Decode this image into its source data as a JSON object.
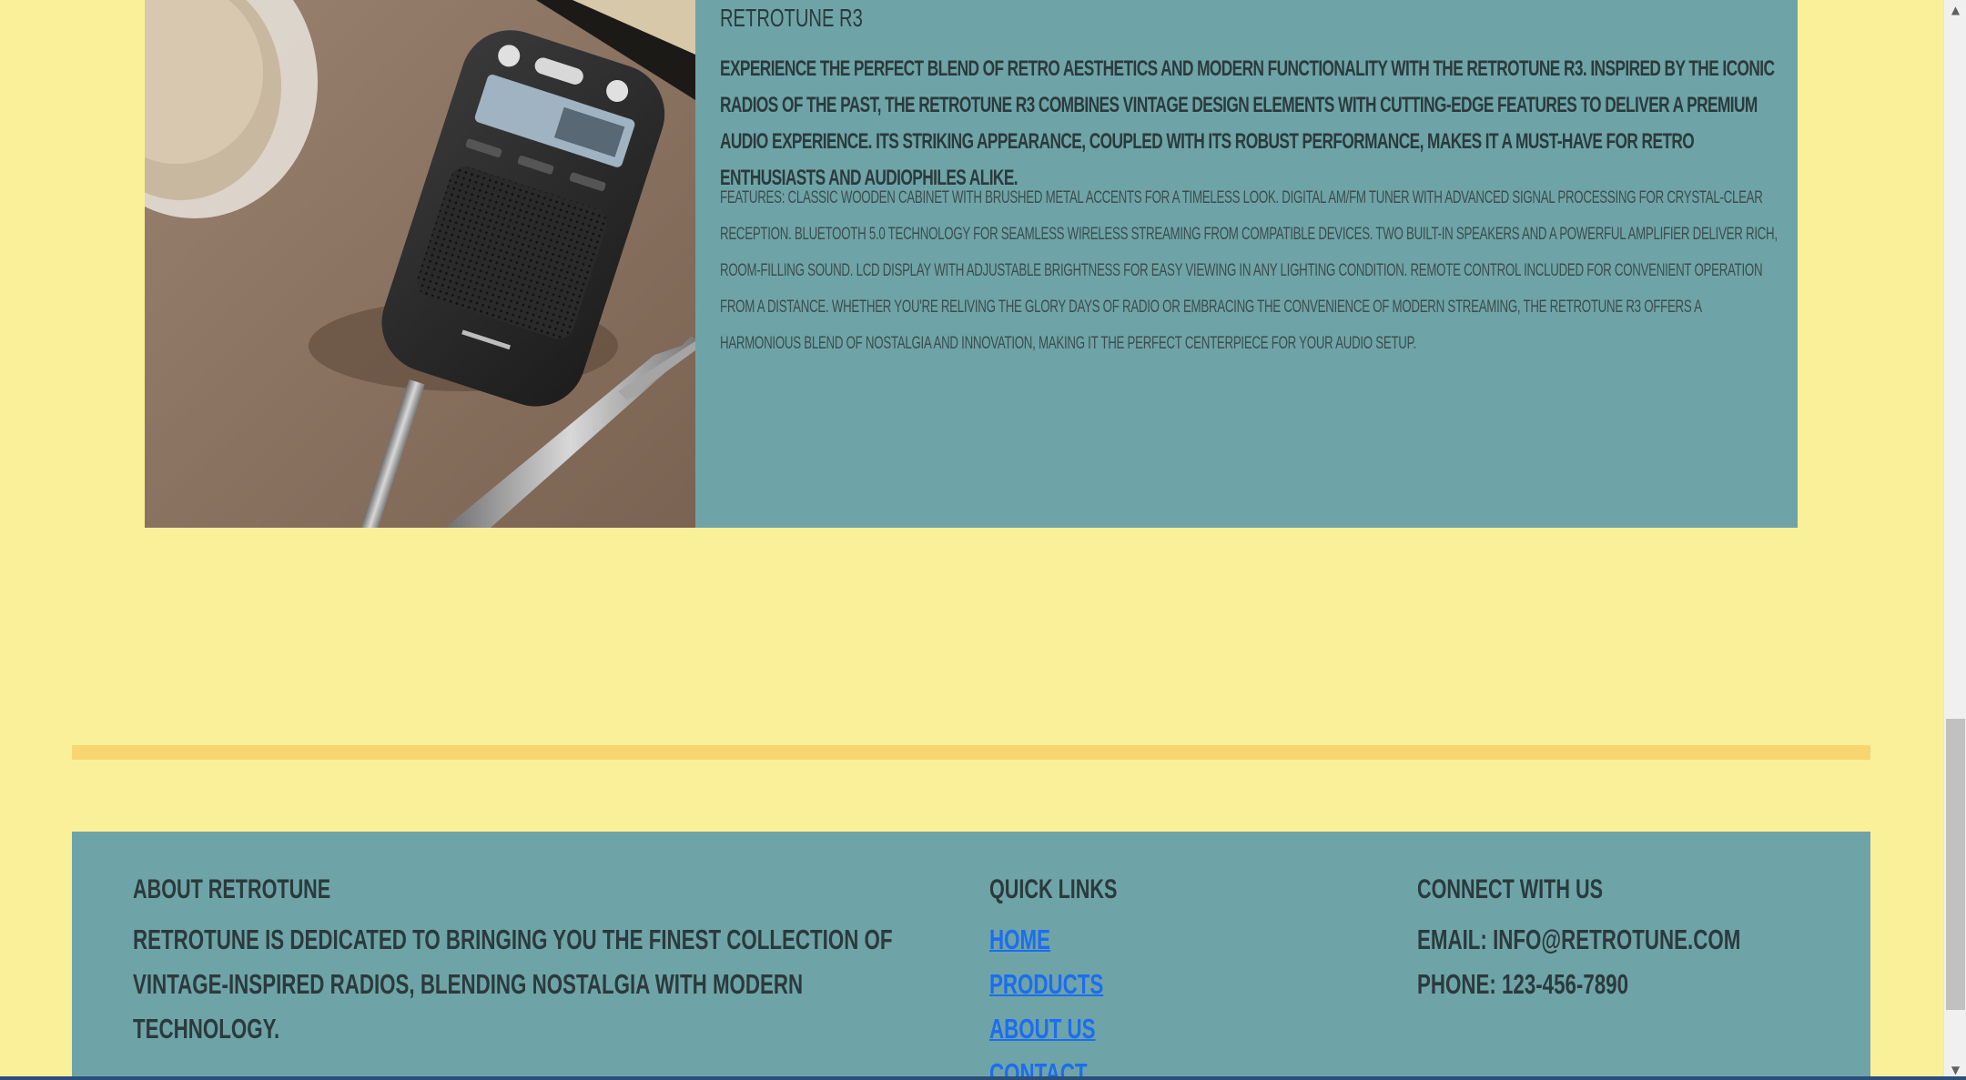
{
  "product": {
    "title": "RetroTune R3",
    "intro": "Experience the perfect blend of retro aesthetics and modern functionality with the RetroTune R3. Inspired by the iconic radios of the past, the RetroTune R3 combines vintage design elements with cutting-edge features to deliver a premium audio experience. Its striking appearance, coupled with its robust performance, makes it a must-have for retro enthusiasts and audiophiles alike.",
    "features": "Features: Classic wooden cabinet with brushed metal accents for a timeless look. Digital AM/FM tuner with advanced signal processing for crystal-clear reception. Bluetooth 5.0 technology for seamless wireless streaming from compatible devices. Two built-in speakers and a powerful amplifier deliver rich, room-filling sound. LCD display with adjustable brightness for easy viewing in any lighting condition. Remote control included for convenient operation from a distance. Whether you're reliving the glory days of radio or embracing the convenience of modern streaming, the RetroTune R3 offers a harmonious blend of nostalgia and innovation, making it the perfect centerpiece for your audio setup."
  },
  "footer": {
    "about": {
      "heading": "About RetroTune",
      "body": "RetroTune is dedicated to bringing you the finest collection of vintage-inspired radios, blending nostalgia with modern technology."
    },
    "quick_links": {
      "heading": "Quick Links",
      "items": [
        "Home",
        "Products",
        "About Us",
        "Contact"
      ]
    },
    "connect": {
      "heading": "Connect With Us",
      "email": "Email: info@retrotune.com",
      "phone": "Phone: 123-456-7890"
    }
  },
  "scrollbar": {
    "up_arrow_icon": "up-arrow-icon",
    "down_arrow_icon": "down-arrow-icon"
  },
  "colors": {
    "page_background": "#fbf09a",
    "card_background": "#6ea4a7",
    "divider": "#f7d56f",
    "link": "#1c6df0",
    "text": "#2b3a3c"
  }
}
